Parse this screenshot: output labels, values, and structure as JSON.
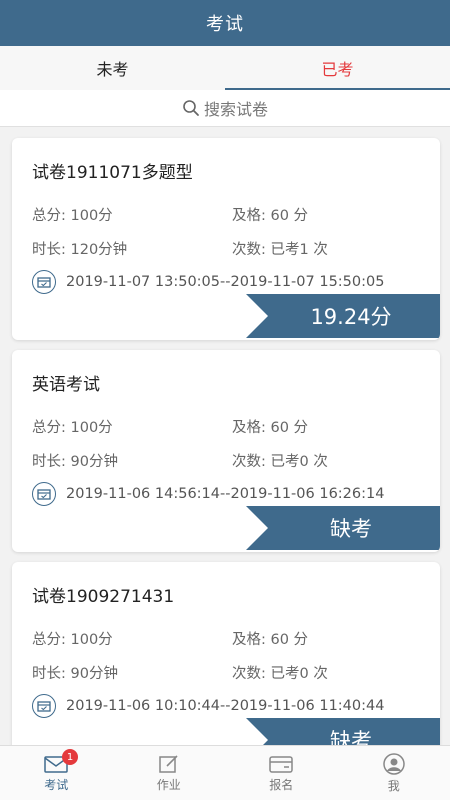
{
  "header": {
    "title": "考试"
  },
  "tabs": [
    {
      "label": "未考",
      "active": false
    },
    {
      "label": "已考",
      "active": true
    }
  ],
  "search": {
    "placeholder": "搜索试卷"
  },
  "exams": [
    {
      "title": "试卷1911071多题型",
      "total_label": "总分:",
      "total": "100分",
      "pass_label": "及格:",
      "pass": "60 分",
      "duration_label": "时长:",
      "duration": "120分钟",
      "times_label": "次数:",
      "times": "已考1 次",
      "time_range": "2019-11-07 13:50:05--2019-11-07 15:50:05",
      "result": "19.24分"
    },
    {
      "title": "英语考试",
      "total_label": "总分:",
      "total": "100分",
      "pass_label": "及格:",
      "pass": "60 分",
      "duration_label": "时长:",
      "duration": "90分钟",
      "times_label": "次数:",
      "times": "已考0 次",
      "time_range": "2019-11-06 14:56:14--2019-11-06 16:26:14",
      "result": "缺考"
    },
    {
      "title": "试卷1909271431",
      "total_label": "总分:",
      "total": "100分",
      "pass_label": "及格:",
      "pass": "60 分",
      "duration_label": "时长:",
      "duration": "90分钟",
      "times_label": "次数:",
      "times": "已考0 次",
      "time_range": "2019-11-06 10:10:44--2019-11-06 11:40:44",
      "result": "缺考"
    }
  ],
  "nav": {
    "items": [
      {
        "label": "考试",
        "icon": "mail-icon",
        "badge": "1"
      },
      {
        "label": "作业",
        "icon": "edit-icon"
      },
      {
        "label": "报名",
        "icon": "card-icon"
      },
      {
        "label": "我",
        "icon": "user-icon"
      }
    ]
  },
  "colors": {
    "primary": "#3f6a8c",
    "accent": "#e4393c"
  }
}
